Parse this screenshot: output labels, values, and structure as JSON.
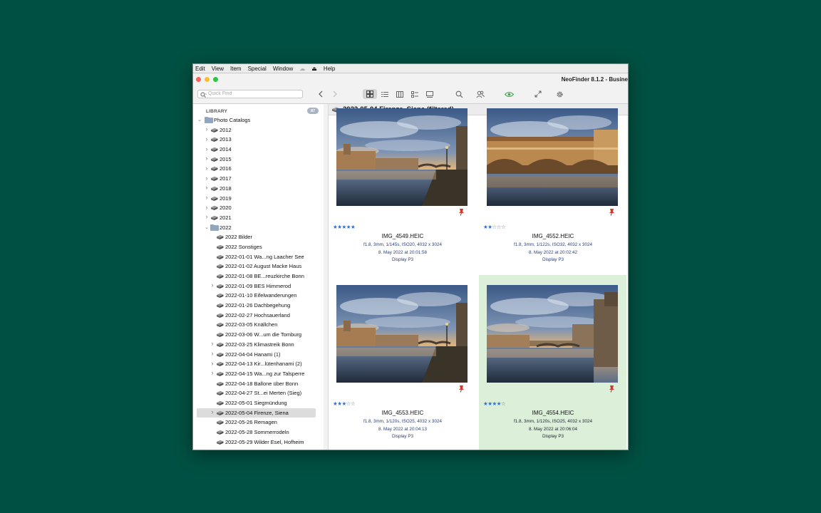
{
  "menu": [
    "Edit",
    "View",
    "Item",
    "Special",
    "Window",
    "Help"
  ],
  "window": {
    "title": "NeoFinder 8.1.2 - Busine"
  },
  "toolbar": {
    "search_placeholder": "Quick Find"
  },
  "library": {
    "header": "LIBRARY",
    "count": "87",
    "root": "Photo Catalogs",
    "items": [
      {
        "label": "2012",
        "level": 1,
        "chevron": ">",
        "icon": "disk",
        "selected": false
      },
      {
        "label": "2013",
        "level": 1,
        "chevron": ">",
        "icon": "disk",
        "selected": false
      },
      {
        "label": "2014",
        "level": 1,
        "chevron": ">",
        "icon": "disk",
        "selected": false
      },
      {
        "label": "2015",
        "level": 1,
        "chevron": ">",
        "icon": "disk",
        "selected": false
      },
      {
        "label": "2016",
        "level": 1,
        "chevron": ">",
        "icon": "disk",
        "selected": false
      },
      {
        "label": "2017",
        "level": 1,
        "chevron": ">",
        "icon": "disk",
        "selected": false
      },
      {
        "label": "2018",
        "level": 1,
        "chevron": ">",
        "icon": "disk",
        "selected": false
      },
      {
        "label": "2019",
        "level": 1,
        "chevron": ">",
        "icon": "disk",
        "selected": false
      },
      {
        "label": "2020",
        "level": 1,
        "chevron": ">",
        "icon": "disk",
        "selected": false
      },
      {
        "label": "2021",
        "level": 1,
        "chevron": ">",
        "icon": "disk",
        "selected": false
      },
      {
        "label": "2022",
        "level": 1,
        "chevron": "v",
        "icon": "folder",
        "selected": false
      },
      {
        "label": "2022 Bilder",
        "level": 2,
        "chevron": "",
        "icon": "disk",
        "selected": false
      },
      {
        "label": "2022 Sonstiges",
        "level": 2,
        "chevron": "",
        "icon": "disk",
        "selected": false
      },
      {
        "label": "2022-01-01 Wa...ng Laacher See",
        "level": 2,
        "chevron": "",
        "icon": "disk",
        "selected": false
      },
      {
        "label": "2022-01-02 August Macke Haus",
        "level": 2,
        "chevron": "",
        "icon": "disk",
        "selected": false
      },
      {
        "label": "2022-01-08 BE...reuzkirche Bonn",
        "level": 2,
        "chevron": "",
        "icon": "disk",
        "selected": false
      },
      {
        "label": "2022-01-09 BES Himmerod",
        "level": 2,
        "chevron": ">",
        "icon": "disk",
        "selected": false
      },
      {
        "label": "2022-01-10 Eifelwanderungen",
        "level": 2,
        "chevron": "",
        "icon": "disk",
        "selected": false
      },
      {
        "label": "2022-01-26 Dachbegehung",
        "level": 2,
        "chevron": "",
        "icon": "disk",
        "selected": false
      },
      {
        "label": "2022-02-27 Hochsauerland",
        "level": 2,
        "chevron": "",
        "icon": "disk",
        "selected": false
      },
      {
        "label": "2022-03-05 Knällchen",
        "level": 2,
        "chevron": "",
        "icon": "disk",
        "selected": false
      },
      {
        "label": "2022-03-06 W...um die Tomburg",
        "level": 2,
        "chevron": "",
        "icon": "disk",
        "selected": false
      },
      {
        "label": "2022-03-25 Klimastreik Bonn",
        "level": 2,
        "chevron": ">",
        "icon": "disk",
        "selected": false
      },
      {
        "label": "2022-04-04 Hanami (1)",
        "level": 2,
        "chevron": ">",
        "icon": "disk",
        "selected": false
      },
      {
        "label": "2022-04-13 Kir...lütenhanami (2)",
        "level": 2,
        "chevron": ">",
        "icon": "disk",
        "selected": false
      },
      {
        "label": "2022-04-15 Wa...ng zur Talsperre",
        "level": 2,
        "chevron": ">",
        "icon": "disk",
        "selected": false
      },
      {
        "label": "2022-04-18 Ballone über Bonn",
        "level": 2,
        "chevron": "",
        "icon": "disk",
        "selected": false
      },
      {
        "label": "2022-04-27 St...ei Merten (Sieg)",
        "level": 2,
        "chevron": "",
        "icon": "disk",
        "selected": false
      },
      {
        "label": "2022-05-01 Siegmündung",
        "level": 2,
        "chevron": "",
        "icon": "disk",
        "selected": false
      },
      {
        "label": "2022-05-04 Firenze, Siena",
        "level": 2,
        "chevron": ">",
        "icon": "disk",
        "selected": true
      },
      {
        "label": "2022-05-26 Remagen",
        "level": 2,
        "chevron": "",
        "icon": "disk",
        "selected": false
      },
      {
        "label": "2022-05-28 Sommerrodeln",
        "level": 2,
        "chevron": "",
        "icon": "disk",
        "selected": false
      },
      {
        "label": "2022-05-29 Wilder Esel, Hofheim",
        "level": 2,
        "chevron": "",
        "icon": "disk",
        "selected": false
      }
    ]
  },
  "content": {
    "title": "2022-05-04 Firenze, Siena  (filtered)",
    "photos": [
      {
        "filename": "IMG_4549.HEIC",
        "rating": 5,
        "exif": "f1.8, 3mm, 1/145s, ISO20, 4032 x 3024",
        "date": "8. May 2022 at 20:01:58",
        "profile": "Display P3",
        "highlighted": false,
        "scene": "bridge-left"
      },
      {
        "filename": "IMG_4552.HEIC",
        "rating": 2,
        "exif": "f1.8, 3mm, 1/122s, ISO32, 4032 x 3024",
        "date": "8. May 2022 at 20:02:42",
        "profile": "Display P3",
        "highlighted": false,
        "scene": "ponte-vecchio"
      },
      {
        "filename": "IMG_4553.HEIC",
        "rating": 3,
        "exif": "f1.8, 3mm, 1/120s, ISO25, 4032 x 3024",
        "date": "8. May 2022 at 20:04:13",
        "profile": "Display P3",
        "highlighted": false,
        "scene": "bridge-left"
      },
      {
        "filename": "IMG_4554.HEIC",
        "rating": 4,
        "exif": "f1.8, 3mm, 1/120s, ISO25, 4032 x 3024",
        "date": "8. May 2022 at 20:06:04",
        "profile": "Display P3",
        "highlighted": true,
        "scene": "river-right"
      }
    ]
  },
  "colors": {
    "accent": "#2f6fcf",
    "highlight": "#dcefd8",
    "selection": "#dcdcdc",
    "pin": "#d9362a",
    "eye": "#3aa64a"
  }
}
